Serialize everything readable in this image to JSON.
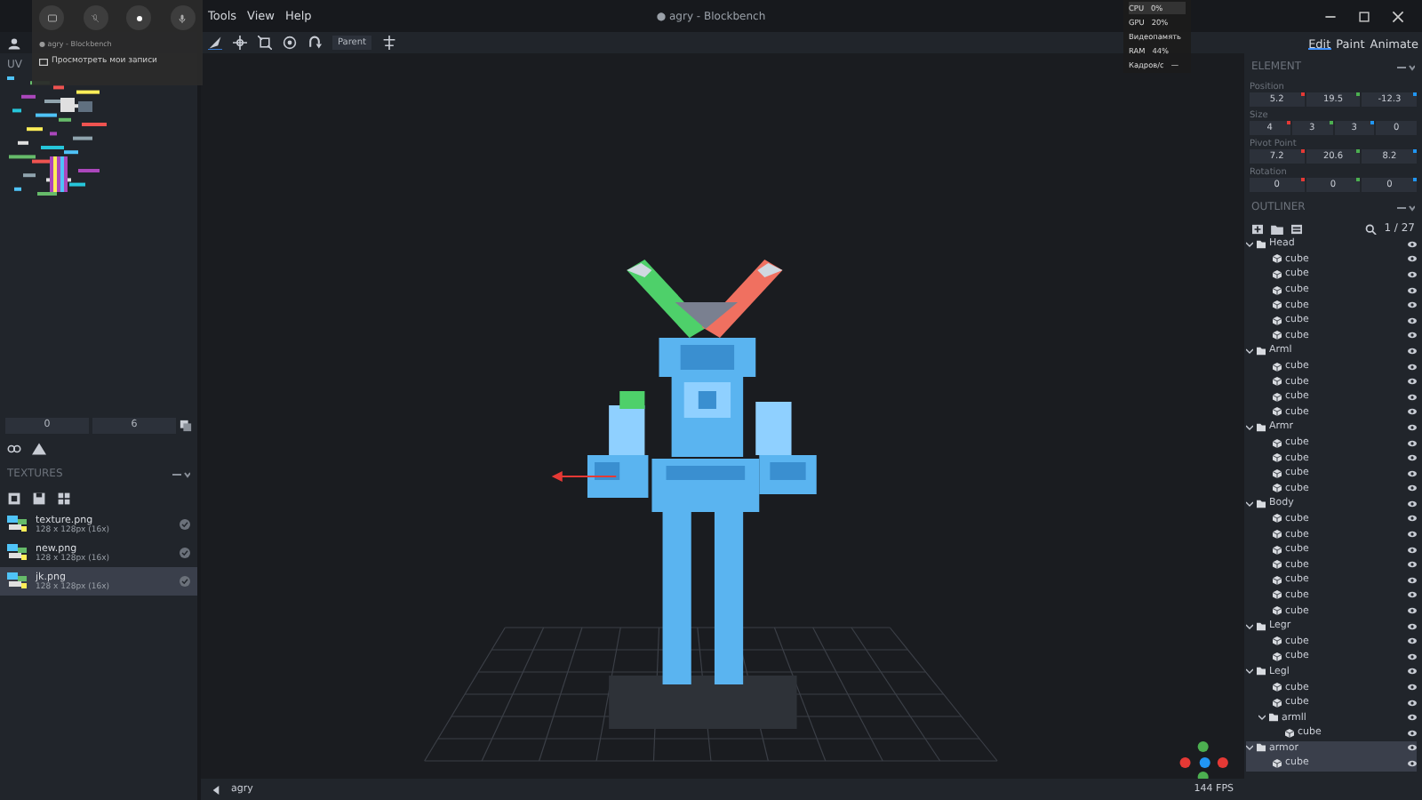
{
  "window": {
    "title": "● agry - Blockbench",
    "menu": [
      "Tools",
      "View",
      "Help"
    ]
  },
  "game_bar": {
    "window_label": "● agry - Blockbench",
    "link": "Просмотреть мои записи"
  },
  "performance": [
    {
      "label": "CPU",
      "value": "0%"
    },
    {
      "label": "GPU",
      "value": "20%"
    },
    {
      "label": "Видеопамять"
    },
    {
      "label": "RAM",
      "value": "44%"
    },
    {
      "label": "Кадров/с",
      "value": "—"
    }
  ],
  "toolbar": {
    "space": "Parent"
  },
  "left_panel": {
    "uv_label": "UV",
    "uv_fields": [
      "0",
      "6"
    ],
    "textures_title": "TEXTURES",
    "textures": [
      {
        "name": "texture.png",
        "size": "128 x 128px (16x)",
        "selected": false
      },
      {
        "name": "new.png",
        "size": "128 x 128px (16x)",
        "selected": false
      },
      {
        "name": "jk.png",
        "size": "128 x 128px (16x)",
        "selected": true
      }
    ]
  },
  "modes": [
    {
      "label": "Edit",
      "selected": true
    },
    {
      "label": "Paint",
      "selected": false
    },
    {
      "label": "Animate",
      "selected": false
    }
  ],
  "element": {
    "title": "ELEMENT",
    "properties": [
      {
        "label": "Position",
        "values": [
          "5.2",
          "19.5",
          "-12.3"
        ]
      },
      {
        "label": "Size",
        "values": [
          "4",
          "3",
          "3",
          "0"
        ]
      },
      {
        "label": "Pivot Point",
        "values": [
          "7.2",
          "20.6",
          "8.2"
        ]
      },
      {
        "label": "Rotation",
        "values": [
          "0",
          "0",
          "0"
        ]
      }
    ]
  },
  "outliner": {
    "title": "OUTLINER",
    "count": "1 / 27",
    "items": [
      {
        "name": "Head",
        "kind": "group",
        "expanded": true,
        "selected": false,
        "children": [
          {
            "name": "cube",
            "kind": "cube",
            "selected": false
          },
          {
            "name": "cube",
            "kind": "cube",
            "selected": false
          },
          {
            "name": "cube",
            "kind": "cube",
            "selected": false
          },
          {
            "name": "cube",
            "kind": "cube",
            "selected": false
          },
          {
            "name": "cube",
            "kind": "cube",
            "selected": false
          },
          {
            "name": "cube",
            "kind": "cube",
            "selected": false
          }
        ]
      },
      {
        "name": "Arml",
        "kind": "group",
        "expanded": true,
        "selected": false,
        "children": [
          {
            "name": "cube",
            "kind": "cube",
            "selected": false
          },
          {
            "name": "cube",
            "kind": "cube",
            "selected": false
          },
          {
            "name": "cube",
            "kind": "cube",
            "selected": false
          },
          {
            "name": "cube",
            "kind": "cube",
            "selected": false
          }
        ]
      },
      {
        "name": "Armr",
        "kind": "group",
        "expanded": true,
        "selected": false,
        "children": [
          {
            "name": "cube",
            "kind": "cube",
            "selected": false
          },
          {
            "name": "cube",
            "kind": "cube",
            "selected": false
          },
          {
            "name": "cube",
            "kind": "cube",
            "selected": false
          },
          {
            "name": "cube",
            "kind": "cube",
            "selected": false
          }
        ]
      },
      {
        "name": "Body",
        "kind": "group",
        "expanded": true,
        "selected": false,
        "children": [
          {
            "name": "cube",
            "kind": "cube",
            "selected": false
          },
          {
            "name": "cube",
            "kind": "cube",
            "selected": false
          },
          {
            "name": "cube",
            "kind": "cube",
            "selected": false
          },
          {
            "name": "cube",
            "kind": "cube",
            "selected": false
          },
          {
            "name": "cube",
            "kind": "cube",
            "selected": false
          },
          {
            "name": "cube",
            "kind": "cube",
            "selected": false
          },
          {
            "name": "cube",
            "kind": "cube",
            "selected": false
          }
        ]
      },
      {
        "name": "Legr",
        "kind": "group",
        "expanded": true,
        "selected": false,
        "children": [
          {
            "name": "cube",
            "kind": "cube",
            "selected": false
          },
          {
            "name": "cube",
            "kind": "cube",
            "selected": false
          }
        ]
      },
      {
        "name": "Legl",
        "kind": "group",
        "expanded": true,
        "selected": false,
        "children": [
          {
            "name": "cube",
            "kind": "cube",
            "selected": false
          },
          {
            "name": "cube",
            "kind": "cube",
            "selected": false
          },
          {
            "name": "armll",
            "kind": "group",
            "expanded": true,
            "selected": false,
            "children": [
              {
                "name": "cube",
                "kind": "cube",
                "selected": false
              }
            ]
          }
        ]
      },
      {
        "name": "armor",
        "kind": "group",
        "expanded": true,
        "selected": true,
        "children": [
          {
            "name": "cube",
            "kind": "cube",
            "selected": true
          }
        ]
      }
    ]
  },
  "status_bar": {
    "project": "agry",
    "fps": "144 FPS"
  }
}
